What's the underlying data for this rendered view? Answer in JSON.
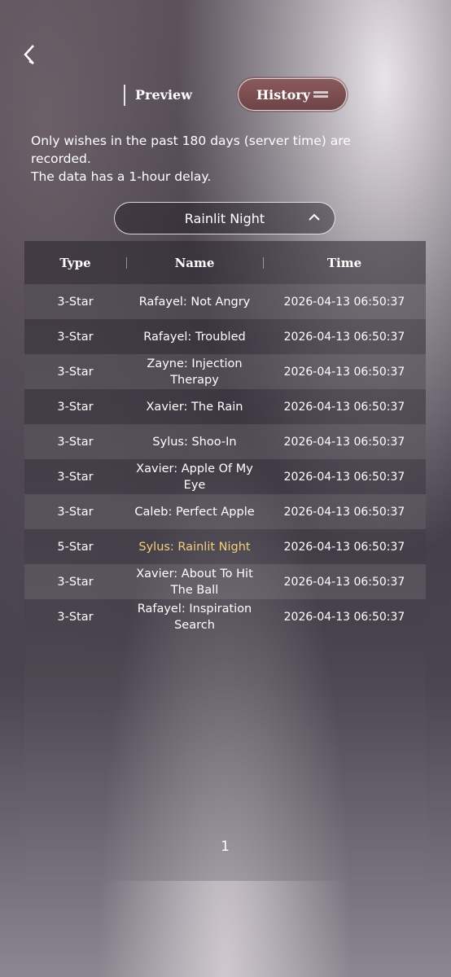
{
  "header": {
    "back_icon": "chevron-left-icon",
    "tabs": [
      {
        "label": "Preview",
        "active": false
      },
      {
        "label": "History",
        "active": true
      }
    ]
  },
  "notice": {
    "line1": "Only wishes in the past 180 days (server time) are recorded.",
    "line2": "The data has a 1-hour delay."
  },
  "filter": {
    "selected": "Rainlit Night",
    "icon": "chevron-up-icon"
  },
  "table": {
    "columns": [
      "Type",
      "Name",
      "Time"
    ],
    "rows": [
      {
        "type": "3-Star",
        "name": "Rafayel: Not Angry",
        "time": "2026-04-13 06:50:37"
      },
      {
        "type": "3-Star",
        "name": "Rafayel: Troubled",
        "time": "2026-04-13 06:50:37"
      },
      {
        "type": "3-Star",
        "name": "Zayne: Injection Therapy",
        "time": "2026-04-13 06:50:37"
      },
      {
        "type": "3-Star",
        "name": "Xavier: The Rain",
        "time": "2026-04-13 06:50:37"
      },
      {
        "type": "3-Star",
        "name": "Sylus: Shoo-In",
        "time": "2026-04-13 06:50:37"
      },
      {
        "type": "3-Star",
        "name": "Xavier: Apple Of My Eye",
        "time": "2026-04-13 06:50:37"
      },
      {
        "type": "3-Star",
        "name": "Caleb: Perfect Apple",
        "time": "2026-04-13 06:50:37"
      },
      {
        "type": "5-Star",
        "name": "Sylus: Rainlit Night",
        "time": "2026-04-13 06:50:37"
      },
      {
        "type": "3-Star",
        "name": "Xavier: About To Hit The Ball",
        "time": "2026-04-13 06:50:37"
      },
      {
        "type": "3-Star",
        "name": "Rafayel: Inspiration Search",
        "time": "2026-04-13 06:50:37"
      }
    ]
  },
  "pagination": {
    "page": "1"
  },
  "colors": {
    "highlight_5star": "#f1cf7e",
    "history_tab": "#7a4e50"
  }
}
